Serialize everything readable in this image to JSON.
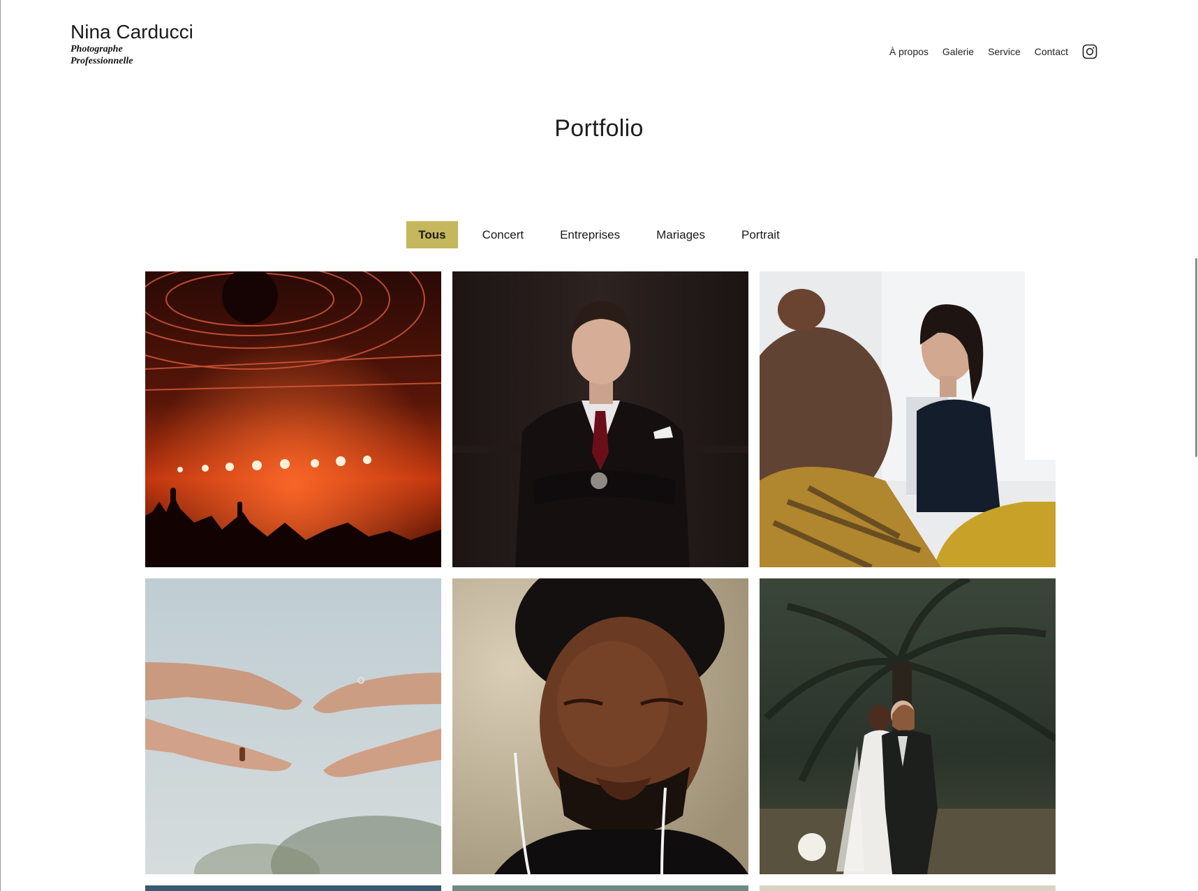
{
  "brand": {
    "name": "Nina Carducci",
    "subtitle_line1": "Photographe",
    "subtitle_line2": "Professionnelle"
  },
  "nav": {
    "items": [
      {
        "label": "À propos"
      },
      {
        "label": "Galerie"
      },
      {
        "label": "Service"
      },
      {
        "label": "Contact"
      }
    ],
    "instagram_icon": "instagram-icon"
  },
  "page": {
    "title": "Portfolio"
  },
  "filters": [
    {
      "label": "Tous",
      "active": true
    },
    {
      "label": "Concert",
      "active": false
    },
    {
      "label": "Entreprises",
      "active": false
    },
    {
      "label": "Mariages",
      "active": false
    },
    {
      "label": "Portrait",
      "active": false
    }
  ],
  "colors": {
    "accent": "#c4b75c"
  },
  "gallery": {
    "tiles": [
      {
        "subject": "concert"
      },
      {
        "subject": "entreprise-homme"
      },
      {
        "subject": "entreprise-femme"
      },
      {
        "subject": "mariage-mains"
      },
      {
        "subject": "portrait"
      },
      {
        "subject": "mariage-couple"
      }
    ]
  }
}
